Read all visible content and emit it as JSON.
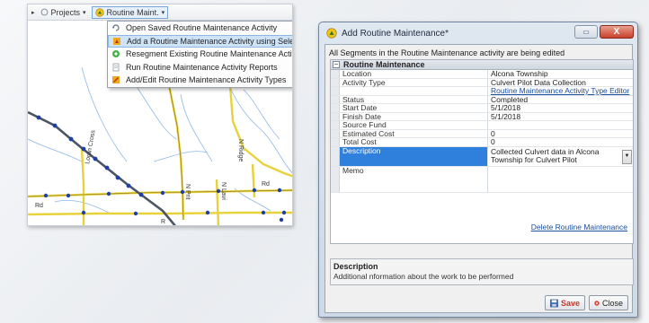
{
  "map": {
    "toolbar": {
      "projects_label": "Projects",
      "routine_label": "Routine Maint."
    },
    "menu": [
      {
        "label": "Open Saved Routine Maintenance Activity",
        "icon": "refresh-icon",
        "highlighted": false
      },
      {
        "label": "Add a Routine Maintenance Activity using Selection",
        "icon": "add-activity-icon",
        "highlighted": true
      },
      {
        "label": "Resegment Existing Routine Maintenance Activity",
        "icon": "resegment-icon",
        "highlighted": false
      },
      {
        "label": "Run Routine Maintenance Activity Reports",
        "icon": "report-icon",
        "highlighted": false
      },
      {
        "label": "Add/Edit Routine Maintenance Activity Types",
        "icon": "edit-types-icon",
        "highlighted": false
      }
    ],
    "road_labels": [
      "Loran Cross",
      "Rd",
      "N Prit",
      "N Lavi",
      "N Ridge",
      "Rd",
      "R"
    ]
  },
  "dialog": {
    "title": "Add Routine Maintenance*",
    "min_glyph": "▭",
    "close_glyph": "X",
    "info": "All Segments in the Routine Maintenance activity are being edited",
    "section_title": "Routine Maintenance",
    "section_toggle": "−",
    "fields": [
      {
        "label": "Location",
        "value": "Alcona Township"
      },
      {
        "label": "Activity Type",
        "value": "Culvert Pilot Data Collection"
      }
    ],
    "type_editor_link": "Routine Maintenance Activity Type Editor",
    "fields2": [
      {
        "label": "Status",
        "value": "Completed"
      },
      {
        "label": "Start Date",
        "value": "5/1/2018"
      },
      {
        "label": "Finish Date",
        "value": "5/1/2018"
      },
      {
        "label": "Source Fund",
        "value": ""
      },
      {
        "label": "Estimated Cost",
        "value": "0"
      },
      {
        "label": "Total Cost",
        "value": "0"
      }
    ],
    "description": {
      "label": "Description",
      "value": "Collected Culvert data in Alcona Township for Culvert Pilot",
      "dropdown_glyph": "▼"
    },
    "memo": {
      "label": "Memo",
      "value": ""
    },
    "delete_link": "Delete Routine Maintenance",
    "help": {
      "title": "Description",
      "text": "Additional nformation about the work to be performed"
    },
    "save_label": "Save",
    "close_label": "Close"
  },
  "colors": {
    "selection": "#2f7fdc",
    "link": "#1a4ea0",
    "save_text": "#c0392b",
    "road_yellow": "#e8d23c",
    "highway": "#4b5563",
    "stream": "#8fb8e6",
    "node": "#1f3fa8"
  }
}
